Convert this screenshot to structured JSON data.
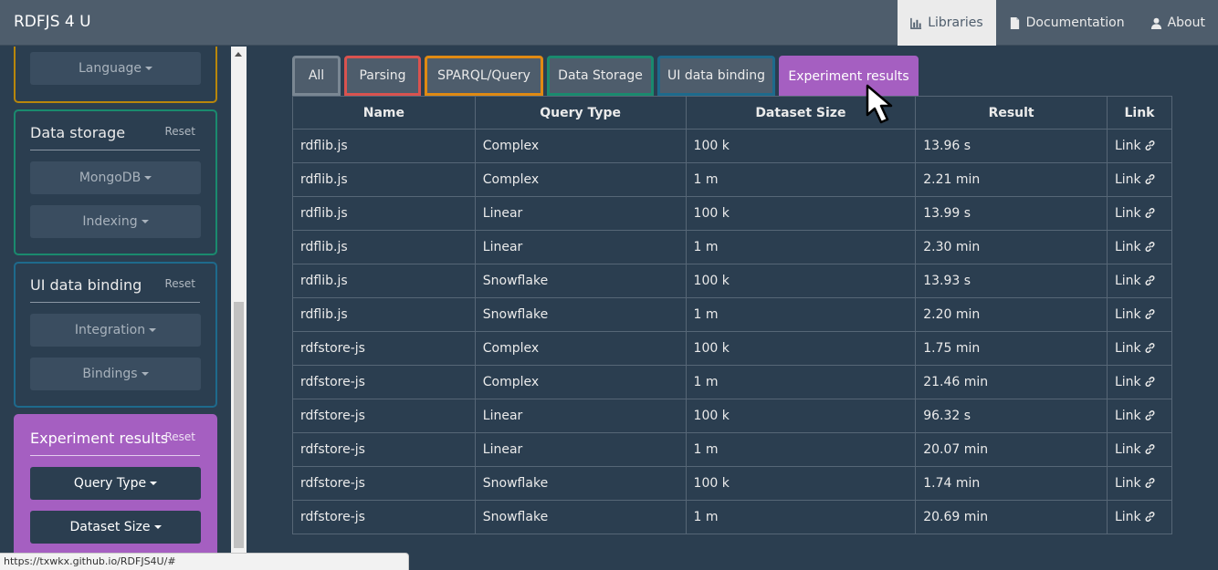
{
  "app": {
    "brand": "RDFJS 4 U"
  },
  "nav": [
    {
      "label": "Libraries",
      "icon": "bar-chart-icon",
      "active": true
    },
    {
      "label": "Documentation",
      "icon": "document-icon",
      "active": false
    },
    {
      "label": "About",
      "icon": "user-icon",
      "active": false
    }
  ],
  "sidebar": {
    "language_button": "Language",
    "data_storage": {
      "title": "Data storage",
      "reset": "Reset",
      "buttons": [
        "MongoDB",
        "Indexing"
      ]
    },
    "ui_binding": {
      "title": "UI data binding",
      "reset": "Reset",
      "buttons": [
        "Integration",
        "Bindings"
      ]
    },
    "experiment": {
      "title": "Experiment results",
      "reset": "Reset",
      "buttons": [
        "Query Type",
        "Dataset Size"
      ]
    }
  },
  "colors": {
    "parsing": "#d9534f",
    "sparql": "#df8a13",
    "data_storage": "#1a8a6e",
    "ui_binding": "#1e6a8c",
    "experiment": "#a55fc1",
    "language": "#b8860b"
  },
  "tabs": [
    {
      "label": "All",
      "color": "#7a8793"
    },
    {
      "label": "Parsing",
      "color": "#d9534f"
    },
    {
      "label": "SPARQL/Query",
      "color": "#df8a13"
    },
    {
      "label": "Data Storage",
      "color": "#1a8a6e"
    },
    {
      "label": "UI data binding",
      "color": "#1e6a8c"
    },
    {
      "label": "Experiment results",
      "color": "#a55fc1",
      "active": true
    }
  ],
  "table": {
    "headers": [
      "Name",
      "Query Type",
      "Dataset Size",
      "Result",
      "Link"
    ],
    "link_label": "Link",
    "rows": [
      [
        "rdflib.js",
        "Complex",
        "100 k",
        "13.96 s"
      ],
      [
        "rdflib.js",
        "Complex",
        "1 m",
        "2.21 min"
      ],
      [
        "rdflib.js",
        "Linear",
        "100 k",
        "13.99 s"
      ],
      [
        "rdflib.js",
        "Linear",
        "1 m",
        "2.30 min"
      ],
      [
        "rdflib.js",
        "Snowflake",
        "100 k",
        "13.93 s"
      ],
      [
        "rdflib.js",
        "Snowflake",
        "1 m",
        "2.20 min"
      ],
      [
        "rdfstore-js",
        "Complex",
        "100 k",
        "1.75 min"
      ],
      [
        "rdfstore-js",
        "Complex",
        "1 m",
        "21.46 min"
      ],
      [
        "rdfstore-js",
        "Linear",
        "100 k",
        "96.32 s"
      ],
      [
        "rdfstore-js",
        "Linear",
        "1 m",
        "20.07 min"
      ],
      [
        "rdfstore-js",
        "Snowflake",
        "100 k",
        "1.74 min"
      ],
      [
        "rdfstore-js",
        "Snowflake",
        "1 m",
        "20.69 min"
      ]
    ]
  },
  "statusbar": {
    "url": "https://txwkx.github.io/RDFJS4U/#"
  }
}
